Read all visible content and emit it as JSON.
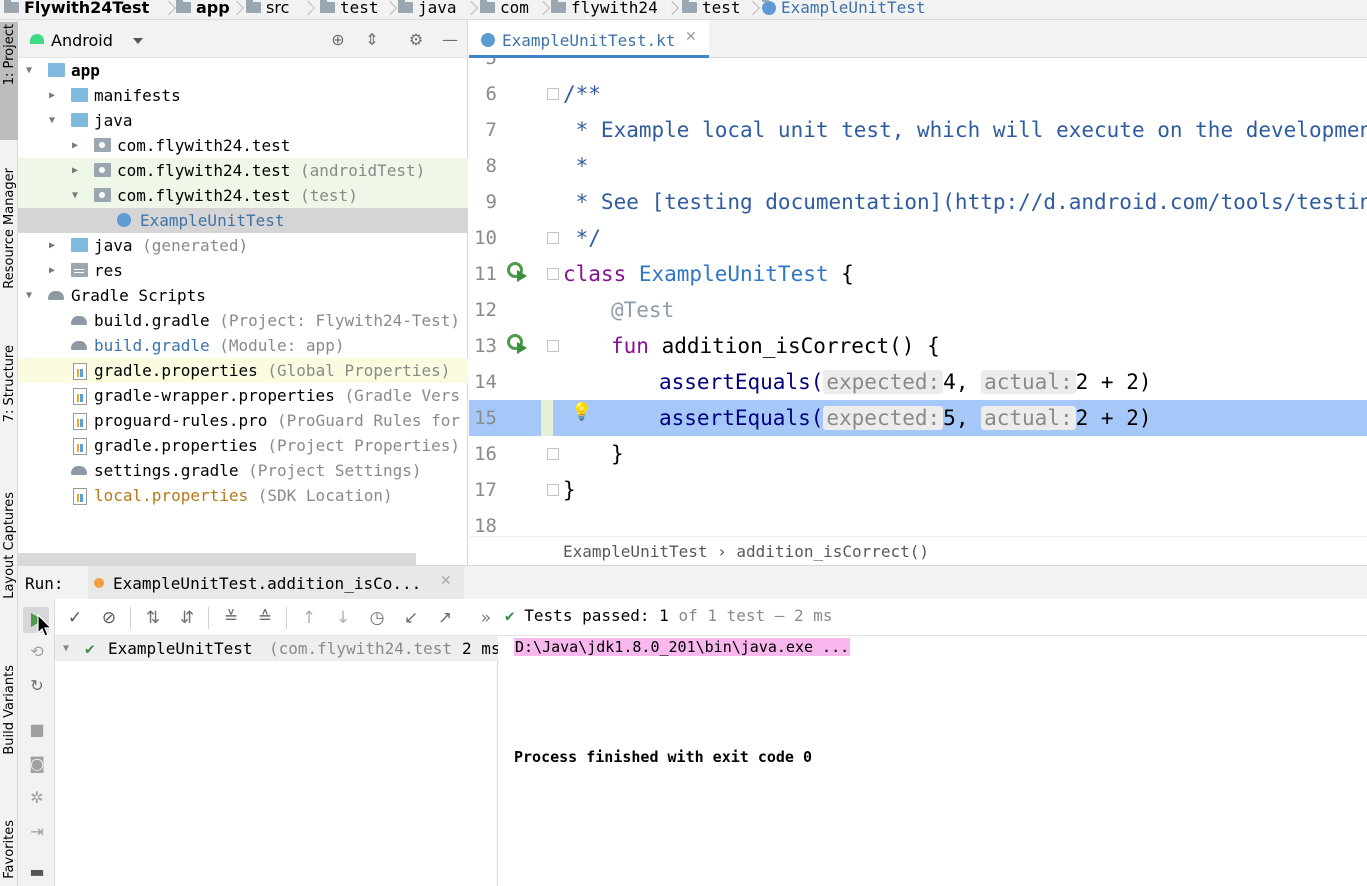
{
  "breadcrumb": {
    "items": [
      "Flywith24Test",
      "app",
      "src",
      "test",
      "java",
      "com",
      "flywith24",
      "test",
      "ExampleUnitTest"
    ]
  },
  "left_stripe": {
    "tabs": [
      "1: Project",
      "Resource Manager",
      "7: Structure",
      "Layout Captures",
      "Build Variants",
      "Favorites"
    ]
  },
  "project_panel": {
    "view_label": "Android",
    "tree": [
      {
        "name": "app",
        "extra": "",
        "icon": "folder-icon"
      },
      {
        "name": "manifests",
        "extra": "",
        "icon": "folder-icon"
      },
      {
        "name": "java",
        "extra": "",
        "icon": "folder-icon"
      },
      {
        "name": "com.flywith24.test",
        "extra": "",
        "icon": "package-icon"
      },
      {
        "name": "com.flywith24.test",
        "extra": "(androidTest)",
        "icon": "package-icon"
      },
      {
        "name": "com.flywith24.test",
        "extra": "(test)",
        "icon": "package-icon"
      },
      {
        "name": "ExampleUnitTest",
        "extra": "",
        "icon": "kotlin-class-icon"
      },
      {
        "name": "java",
        "extra": "(generated)",
        "icon": "generated-folder-icon"
      },
      {
        "name": "res",
        "extra": "",
        "icon": "resources-folder-icon"
      },
      {
        "name": "Gradle Scripts",
        "extra": "",
        "icon": "gradle-icon"
      },
      {
        "name": "build.gradle",
        "extra": "(Project: Flywith24-Test)",
        "icon": "gradle-icon"
      },
      {
        "name": "build.gradle",
        "extra": "(Module: app)",
        "icon": "gradle-icon"
      },
      {
        "name": "gradle.properties",
        "extra": "(Global Properties)",
        "icon": "properties-icon"
      },
      {
        "name": "gradle-wrapper.properties",
        "extra": "(Gradle Vers",
        "icon": "properties-icon"
      },
      {
        "name": "proguard-rules.pro",
        "extra": "(ProGuard Rules for",
        "icon": "properties-icon"
      },
      {
        "name": "gradle.properties",
        "extra": "(Project Properties)",
        "icon": "properties-icon"
      },
      {
        "name": "settings.gradle",
        "extra": "(Project Settings)",
        "icon": "gradle-icon"
      },
      {
        "name": "local.properties",
        "extra": "(SDK Location)",
        "icon": "properties-icon"
      }
    ]
  },
  "editor": {
    "tab_label": "ExampleUnitTest.kt",
    "lines": [
      {
        "num": "5"
      },
      {
        "num": "6",
        "comment": "/**"
      },
      {
        "num": "7",
        "comment": " * Example local unit test, which will execute on the development m"
      },
      {
        "num": "8",
        "comment": " *"
      },
      {
        "num": "9",
        "comment": " * See [testing documentation](http://d.android.com/tools/testing)."
      },
      {
        "num": "10",
        "comment": " */"
      },
      {
        "num": "11",
        "kw": "class",
        "name": "ExampleUnitTest",
        "rest": " {"
      },
      {
        "num": "12",
        "annotation": "@Test"
      },
      {
        "num": "13",
        "kw": "fun",
        "fn": "addition_isCorrect",
        "rest": "() {"
      },
      {
        "num": "14",
        "call": "assertEquals(",
        "hint1": "expected:",
        "v1": "4,",
        "hint2": "actual:",
        "v2": "2 + 2)"
      },
      {
        "num": "15",
        "call": "assertEquals(",
        "hint1": "expected:",
        "v1": "5,",
        "hint2": "actual:",
        "v2": "2 + 2)"
      },
      {
        "num": "16",
        "text": "}"
      },
      {
        "num": "17",
        "text": "}"
      },
      {
        "num": "18"
      }
    ],
    "breadcrumb": "ExampleUnitTest › addition_isCorrect()"
  },
  "run": {
    "label": "Run:",
    "tab_label": "ExampleUnitTest.addition_isCo...",
    "status_passed": "Tests passed:",
    "status_count": "1",
    "status_rest": "of 1 test – 2 ms",
    "tree_item": "ExampleUnitTest",
    "tree_item_pkg": "(com.flywith24.test",
    "tree_item_time": "2 ms",
    "console_line1": "D:\\Java\\jdk1.8.0_201\\bin\\java.exe ...",
    "console_line2": "Process finished with exit code 0"
  }
}
